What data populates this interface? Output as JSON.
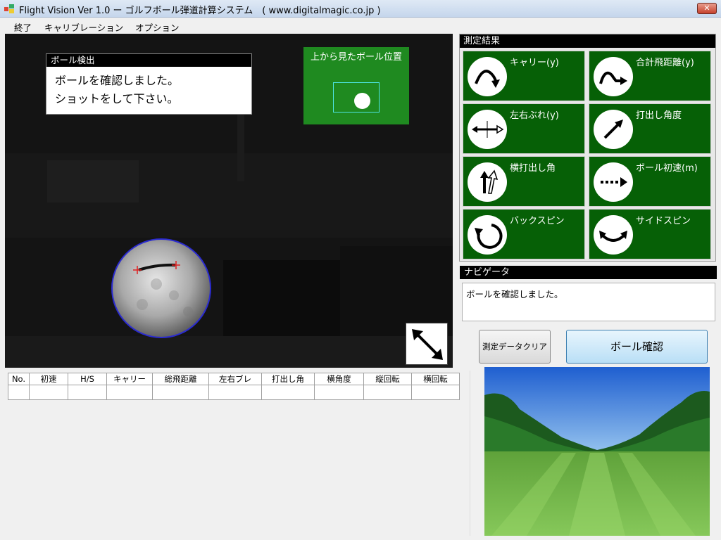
{
  "window": {
    "title": "Flight Vision  Ver 1.0  ー ゴルフボール弾道計算システム　( www.digitalmagic.co.jp )",
    "close_label": "✕"
  },
  "menu": {
    "items": [
      "終了",
      "キャリブレーション",
      "オプション"
    ]
  },
  "camera": {
    "detect_title": "ボール検出",
    "detect_line1": "ボールを確認しました。",
    "detect_line2": "ショットをして下さい。",
    "topview_label": "上から見たボール位置"
  },
  "results": {
    "header": "測定結果",
    "tiles": [
      {
        "label": "キャリー(y)",
        "icon": "carry-arc-icon"
      },
      {
        "label": "合計飛距離(y)",
        "icon": "total-distance-arc-icon"
      },
      {
        "label": "左右ぶれ(y)",
        "icon": "lateral-deviation-icon"
      },
      {
        "label": "打出し角度",
        "icon": "launch-angle-arrow-icon"
      },
      {
        "label": "横打出し角",
        "icon": "side-launch-angle-icon"
      },
      {
        "label": "ボール初速(m)",
        "icon": "ball-speed-dashed-arrow-icon"
      },
      {
        "label": "バックスピン",
        "icon": "backspin-rotation-icon"
      },
      {
        "label": "サイドスピン",
        "icon": "sidespin-rotation-icon"
      }
    ]
  },
  "navigator": {
    "header": "ナビゲータ",
    "message": "ボールを確認しました。"
  },
  "buttons": {
    "clear_label": "測定データクリア",
    "confirm_label": "ボール確認"
  },
  "table": {
    "columns": [
      "No.",
      "初速",
      "H/S",
      "キャリー",
      "総飛距離",
      "左右ブレ",
      "打出し角",
      "横角度",
      "縦回転",
      "横回転"
    ],
    "rows": [
      [
        "",
        "",
        "",
        "",
        "",
        "",
        "",
        "",
        "",
        ""
      ]
    ]
  },
  "colors": {
    "tile_green": "#066006",
    "topview_green": "#1f8a20",
    "ball_outline": "#2b2bd0",
    "marker_red": "#e02020"
  }
}
